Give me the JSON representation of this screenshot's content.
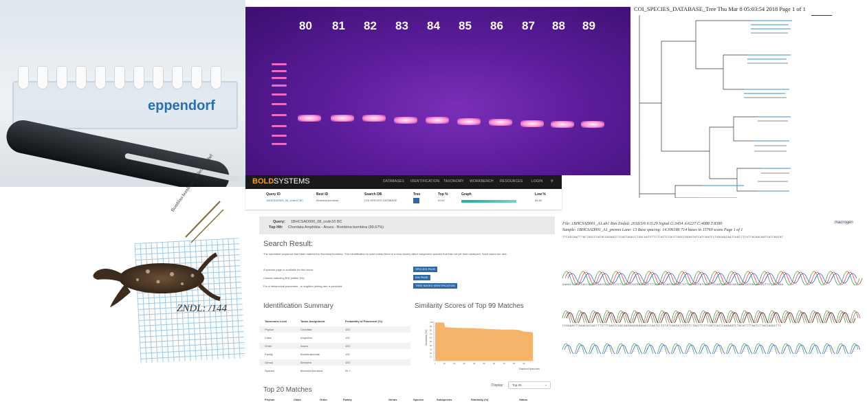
{
  "gel": {
    "lanes": [
      "80",
      "81",
      "82",
      "83",
      "84",
      "85",
      "86",
      "87",
      "88",
      "89"
    ]
  },
  "tree": {
    "title": "COI_SPECIES_DATABASE_Tree  Thu Mar  8 05:03:54 2018  Page 1 of 1"
  },
  "photo": {
    "brand": "eppendorf"
  },
  "bold_header": {
    "logo_bold": "BOLD",
    "logo_systems": "SYSTEMS",
    "nav": [
      "DATABASES",
      "IDENTIFICATION",
      "TAXONOMY",
      "WORKBENCH",
      "RESOURCES",
      "LOGIN"
    ],
    "columns": [
      "Query ID",
      "Best ID",
      "Search DB",
      "Tree",
      "Top %",
      "Graph",
      "Low %"
    ],
    "row": [
      "1BHCSAD000_08_cndn10 BC",
      "Bombina bombina",
      "COI SPECIES DATABASE",
      "",
      "99.67",
      "",
      "84.80"
    ]
  },
  "specimen": {
    "handwritten": "Bombina bombina · collection label",
    "tag": "ZNDL: /144"
  },
  "identification": {
    "query_label": "Query:",
    "query_value": "1BHCSAD000_08_cndn10 BC",
    "top_hit_label": "Top Hit:",
    "top_hit_value": "Chordata Amphibia - Anura - Bombina bombina (99.67%)",
    "search_result": "Search Result:",
    "result_text": "The submitted sequence has been matched to Bombina bombina. This identification is solid unless there is a very closely allied congeneric species that has not yet been analyzed. Such cases are rare.",
    "line1": "A species page is available for this taxon:",
    "line2": "Closest matching BIN (within 3%):",
    "line3": "For a hierarchical placement - a neighbor joining tree is provided:",
    "btn_species": "SPECIES PAGE",
    "btn_bin": "BIN PAGE",
    "btn_tree": "TREE BASED IDENTIFICATION",
    "summary_title": "Identification Summary",
    "similarity_title": "Similarity Scores of Top 99 Matches",
    "table_headers": [
      "Taxonomic Level",
      "Taxon Assignment",
      "Probability of Placement (%)"
    ],
    "table_rows": [
      [
        "Phylum",
        "Chordata",
        "100"
      ],
      [
        "Class",
        "Amphibia",
        "100"
      ],
      [
        "Order",
        "Anura",
        "100"
      ],
      [
        "Family",
        "Bombinatoridae",
        "100"
      ],
      [
        "Genus",
        "Bombina",
        "100"
      ],
      [
        "Species",
        "Bombina bombina",
        "99.7"
      ]
    ],
    "chart_ylabel": "Similarity (%)",
    "chart_xlabel": "Ranked Matches",
    "display_label": "Display:",
    "display_value": "Top 20",
    "top20_title": "Top 20 Matches",
    "top20_headers": [
      "Phylum",
      "Class",
      "Order",
      "Family",
      "Genus",
      "Species",
      "Subspecies",
      "Similarity (%)",
      "Status"
    ]
  },
  "chart_data": {
    "type": "area",
    "title": "Similarity Scores of Top 99 Matches",
    "xlabel": "Ranked Matches",
    "ylabel": "Similarity (%)",
    "x_ticks": [
      "1",
      "10",
      "20",
      "30",
      "40",
      "50",
      "60",
      "70",
      "80",
      "90"
    ],
    "y_ticks": [
      "100",
      "90",
      "80",
      "70",
      "60",
      "50",
      "40",
      "30",
      "20",
      "10"
    ],
    "x": [
      1,
      5,
      10,
      11,
      15,
      20,
      25,
      30,
      40,
      50,
      60,
      70,
      80,
      85,
      90,
      99
    ],
    "values": [
      99.7,
      99.5,
      99,
      87,
      86.5,
      86,
      85.5,
      85,
      84.5,
      83,
      82,
      81,
      81,
      80,
      76,
      74
    ],
    "ylim": [
      0,
      100
    ],
    "color": "#f5b46a"
  },
  "chromatogram": {
    "info1": "File: 1BHCSAD001_A1.ab1    Run Ended: 2018/3/6 6:0:29    Signal G:3454 A:6227 C:4088 T:8380",
    "info2": "Sample: 1BHCSAD001_A1_premix    Lane: 13    Base spacing: 14.306186    714 bases in 15769 scans    Page 1 of 1",
    "brand": "macrogen",
    "seq1": "TTCAGCAATTTACTAGCCCACGCGGGAGCCTCAGTAGACCTGACAATCTTCTCACTCCACCTAGCTGGAGTATCATCAATCCTAGGAGCAATCAACTTTATTACAACAATCATCAATAT",
    "seq2": "GAAACCTCCCCACCATATCAACGCCTCCCTCTATTCGTATGATCAGTTTTAATTACAGCAGTACTATTACTACTATCACTTCCAGTACTAGCAGCAGGCATCACAATACTTCTTACAGA",
    "seq3": "CCGAAACTTAAACACCACTTTCTTTGACCCAGCAGGAGGGGGAGACCCAATCCTCTATCAACATCTGTTCTGATTCTTCGGTCACCCAGAAGTCTACATTTTAATCTTACCAGGCTTC"
  }
}
